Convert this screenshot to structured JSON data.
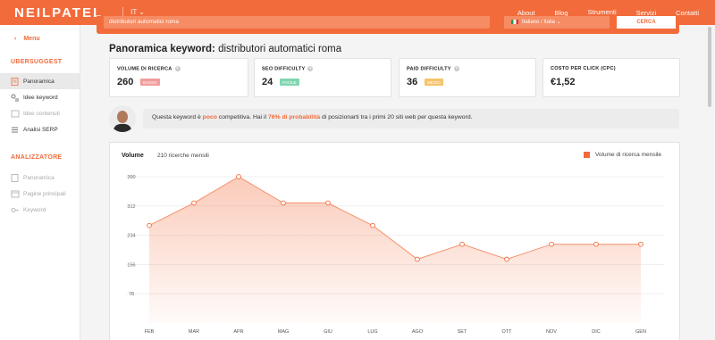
{
  "topbar": {
    "logo": "NEILPATEL",
    "lang": "IT ⌄",
    "nav": [
      "About",
      "Blog",
      "Strumenti",
      "Servizi",
      "Contatti"
    ],
    "active_nav": "Strumenti"
  },
  "search": {
    "value": "distributori automatici roma",
    "language": "Italiano / Italia",
    "button": "CERCA"
  },
  "sidebar": {
    "back_label": "Menu",
    "section1": "UBERSUGGEST",
    "items1": [
      "Panoramica",
      "Idee keyword",
      "Idee contenuti",
      "Analisi SERP"
    ],
    "section2": "ANALIZZATORE",
    "items2": [
      "Panoramica",
      "Pagine principali",
      "Keyword"
    ]
  },
  "page": {
    "title_prefix": "Panoramica keyword:",
    "title_keyword": "distributori automatici roma"
  },
  "metrics": [
    {
      "label": "VOLUME DI RICERCA",
      "value": "260",
      "badge": "BASSO",
      "badge_color": "#f29c9c"
    },
    {
      "label": "SEO DIFFICULTY",
      "value": "24",
      "badge": "FACILE",
      "badge_color": "#7fd6b0"
    },
    {
      "label": "PAID DIFFICULTY",
      "value": "36",
      "badge": "MEDIO",
      "badge_color": "#f6c46b"
    },
    {
      "label": "COSTO PER CLICK (CPC)",
      "value": "€1,52",
      "badge": "",
      "badge_color": ""
    }
  ],
  "advice": {
    "t1": "Questa keyword è ",
    "t2": "poco",
    "t3": " competitiva. Hai il ",
    "t4": "76% di probabilità",
    "t5": " di posizionarti tra i primi 20 siti web per questa keyword."
  },
  "chart_data": {
    "type": "area",
    "title": "Volume",
    "subtitle": "210 ricerche mensili",
    "categories": [
      "FEB",
      "MAR",
      "APR",
      "MAG",
      "GIU",
      "LUG",
      "AGO",
      "SET",
      "OTT",
      "NOV",
      "DIC",
      "GEN"
    ],
    "series": [
      {
        "name": "Volume di ricerca mensile",
        "values": [
          260,
          320,
          390,
          320,
          320,
          260,
          170,
          210,
          170,
          210,
          210,
          210
        ]
      }
    ],
    "yticks": [
      78,
      156,
      234,
      312,
      390
    ],
    "ylim": [
      0,
      390
    ],
    "grid": true,
    "legend": "top-right",
    "color": "#f26b3a"
  }
}
